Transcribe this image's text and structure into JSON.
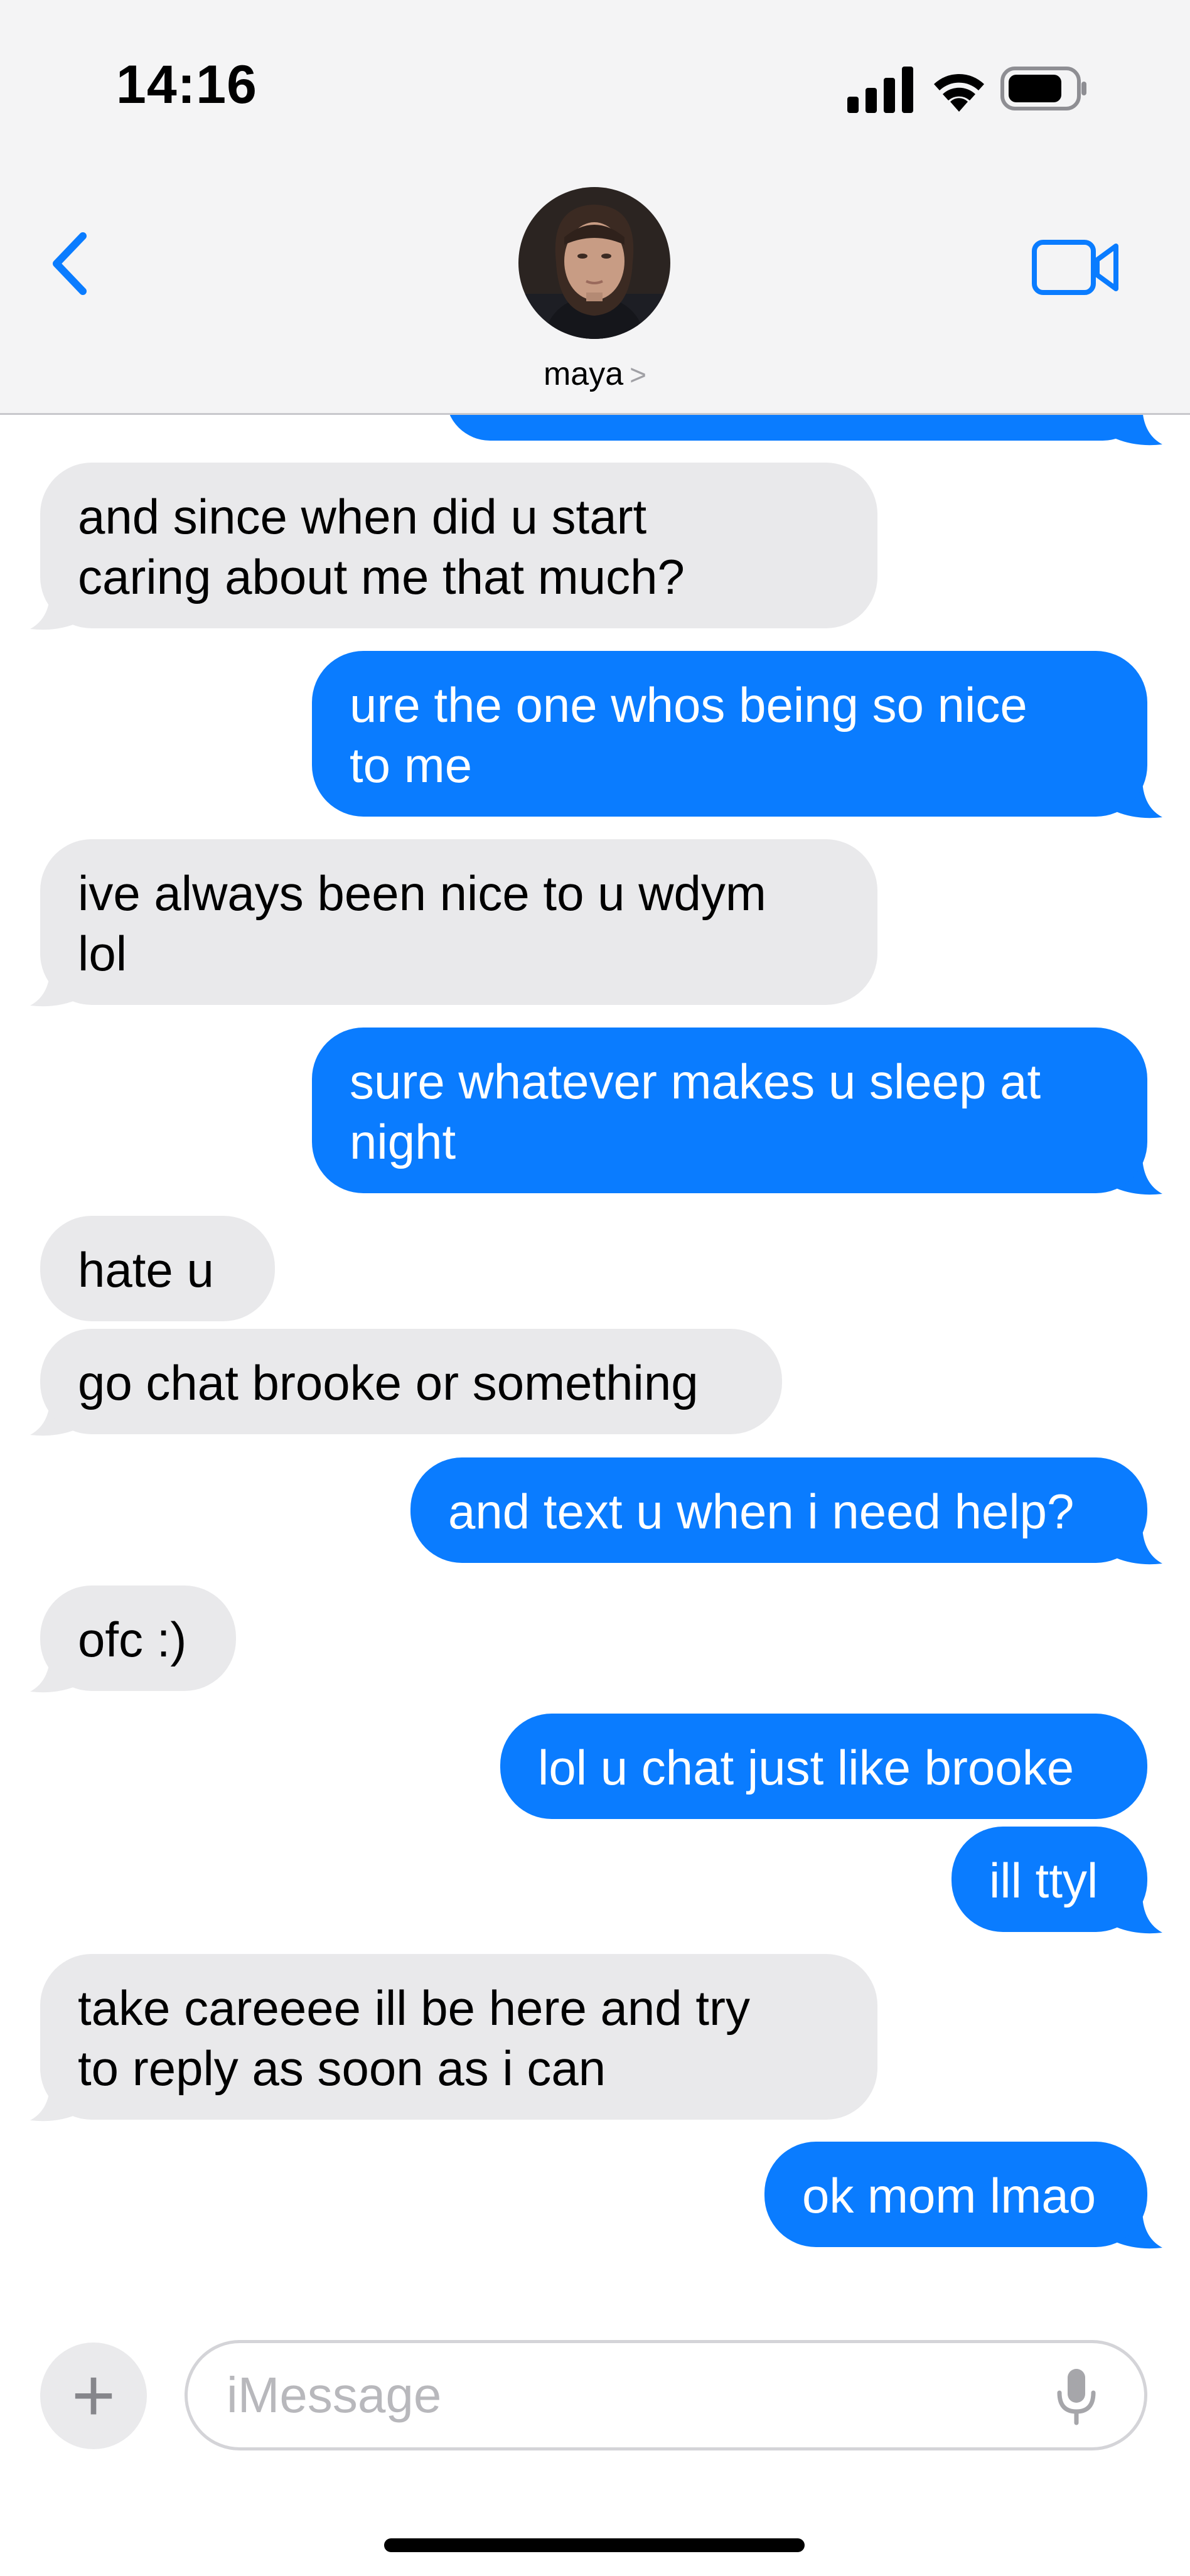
{
  "status_bar": {
    "time": "14:16"
  },
  "header": {
    "contact_name": "maya",
    "contact_chevron": ">",
    "icons": {
      "back": "chevron-left-icon",
      "video": "video-camera-icon"
    },
    "accent_color": "#0a7cff"
  },
  "messages": [
    {
      "direction": "sent",
      "text": ""
    },
    {
      "direction": "received",
      "lines": [
        "and since when did u start",
        "caring about me that much?"
      ]
    },
    {
      "direction": "sent",
      "lines": [
        "ure the one whos being so nice",
        "to me"
      ]
    },
    {
      "direction": "received",
      "lines": [
        "ive always been nice to u wdym",
        "lol"
      ]
    },
    {
      "direction": "sent",
      "lines": [
        "sure whatever makes u sleep at",
        "night"
      ]
    },
    {
      "direction": "received",
      "lines": [
        "hate u"
      ]
    },
    {
      "direction": "received",
      "lines": [
        "go chat brooke or something"
      ]
    },
    {
      "direction": "sent",
      "lines": [
        "and text u when i need help?"
      ]
    },
    {
      "direction": "received",
      "lines": [
        "ofc :)"
      ]
    },
    {
      "direction": "sent",
      "lines": [
        "lol u chat just like brooke"
      ]
    },
    {
      "direction": "sent",
      "lines": [
        "ill ttyl"
      ]
    },
    {
      "direction": "received",
      "lines": [
        "take careeee ill be here and try",
        "to reply as soon as i can"
      ]
    },
    {
      "direction": "sent",
      "lines": [
        "ok mom lmao"
      ]
    }
  ],
  "composer": {
    "placeholder": "iMessage",
    "plus_label": "+",
    "icons": {
      "plus": "plus-icon",
      "mic": "microphone-icon"
    }
  },
  "colors": {
    "sent_bubble": "#0a7cff",
    "received_bubble": "#e9e9eb",
    "header_background": "#f4f4f5"
  }
}
